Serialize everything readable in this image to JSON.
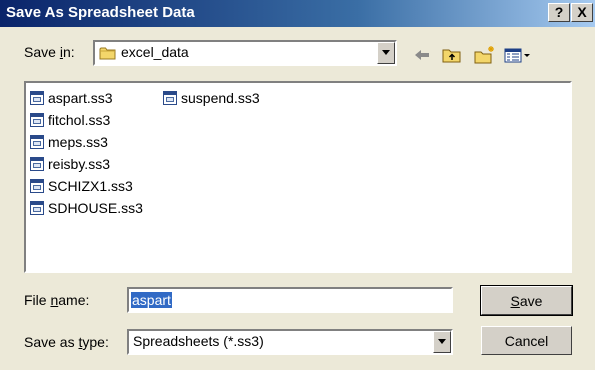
{
  "window": {
    "title": "Save As Spreadsheet Data",
    "help_label": "?",
    "close_label": "X"
  },
  "save_in": {
    "label_prefix": "Save ",
    "label_accel": "i",
    "label_suffix": "n:",
    "value": "excel_data"
  },
  "toolbar": {
    "icons": [
      "back-arrow-icon",
      "up-folder-icon",
      "new-folder-icon",
      "view-menu-icon"
    ]
  },
  "files": [
    {
      "name": "aspart.ss3"
    },
    {
      "name": "fitchol.ss3"
    },
    {
      "name": "meps.ss3"
    },
    {
      "name": "reisby.ss3"
    },
    {
      "name": "SCHIZX1.ss3"
    },
    {
      "name": "SDHOUSE.ss3"
    },
    {
      "name": "suspend.ss3"
    }
  ],
  "file_name": {
    "label_prefix": "File ",
    "label_accel": "n",
    "label_suffix": "ame:",
    "value": "aspart"
  },
  "save_type": {
    "label_prefix": "Save as ",
    "label_accel": "t",
    "label_suffix": "ype:",
    "value": "Spreadsheets (*.ss3)"
  },
  "buttons": {
    "save_accel": "S",
    "save_rest": "ave",
    "cancel": "Cancel"
  },
  "colors": {
    "title_bar": "#0a246a",
    "selection": "#316ac5",
    "face": "#ece9d8"
  }
}
